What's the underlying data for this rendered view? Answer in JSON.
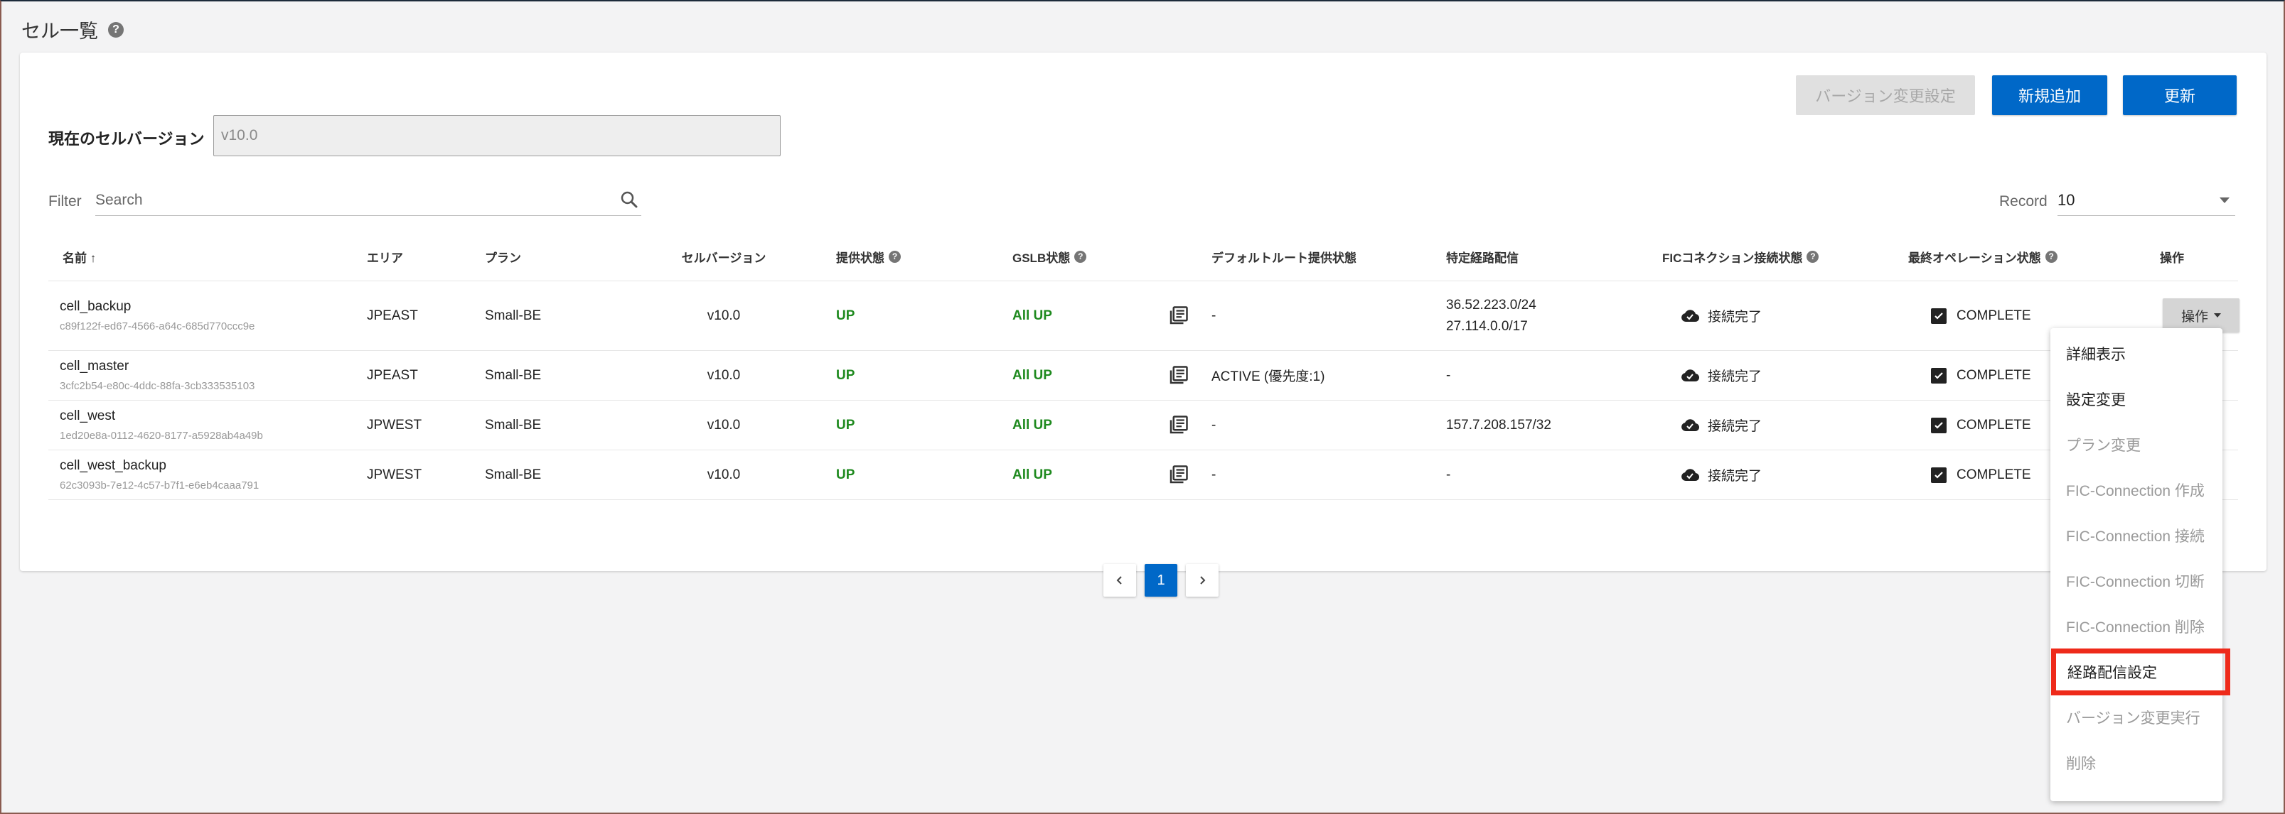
{
  "page": {
    "title": "セル一覧"
  },
  "toolbar": {
    "version_change_label": "バージョン変更設定",
    "add_label": "新規追加",
    "refresh_label": "更新"
  },
  "version": {
    "label": "現在のセルバージョン",
    "value": "v10.0"
  },
  "filter": {
    "label": "Filter",
    "placeholder": "Search"
  },
  "record": {
    "label": "Record",
    "value": "10"
  },
  "table": {
    "headers": {
      "name": "名前 ↑",
      "area": "エリア",
      "plan": "プラン",
      "cell_version": "セルバージョン",
      "service_status": "提供状態",
      "gslb_status": "GSLB状態",
      "default_route": "デフォルトルート提供状態",
      "specific_route": "特定経路配信",
      "fic_status": "FICコネクション接続状態",
      "last_op": "最終オペレーション状態",
      "action": "操作"
    },
    "rows": [
      {
        "name": "cell_backup",
        "id": "c89f122f-ed67-4566-a64c-685d770ccc9e",
        "area": "JPEAST",
        "plan": "Small-BE",
        "version": "v10.0",
        "status": "UP",
        "gslb": "All UP",
        "default_route": "-",
        "routes": [
          "36.52.223.0/24",
          "27.114.0.0/17"
        ],
        "fic": "接続完了",
        "last_op": "COMPLETE",
        "action": "操作"
      },
      {
        "name": "cell_master",
        "id": "3cfc2b54-e80c-4ddc-88fa-3cb333535103",
        "area": "JPEAST",
        "plan": "Small-BE",
        "version": "v10.0",
        "status": "UP",
        "gslb": "All UP",
        "default_route": "ACTIVE (優先度:1)",
        "routes": [
          "-"
        ],
        "fic": "接続完了",
        "last_op": "COMPLETE"
      },
      {
        "name": "cell_west",
        "id": "1ed20e8a-0112-4620-8177-a5928ab4a49b",
        "area": "JPWEST",
        "plan": "Small-BE",
        "version": "v10.0",
        "status": "UP",
        "gslb": "All UP",
        "default_route": "-",
        "routes": [
          "157.7.208.157/32"
        ],
        "fic": "接続完了",
        "last_op": "COMPLETE"
      },
      {
        "name": "cell_west_backup",
        "id": "62c3093b-7e12-4c57-b7f1-e6eb4caaa791",
        "area": "JPWEST",
        "plan": "Small-BE",
        "version": "v10.0",
        "status": "UP",
        "gslb": "All UP",
        "default_route": "-",
        "routes": [
          "-"
        ],
        "fic": "接続完了",
        "last_op": "COMPLETE"
      }
    ]
  },
  "pagination": {
    "current": "1"
  },
  "menu": {
    "items": [
      {
        "label": "詳細表示",
        "disabled": false
      },
      {
        "label": "設定変更",
        "disabled": false
      },
      {
        "label": "プラン変更",
        "disabled": true
      },
      {
        "label": "FIC-Connection 作成",
        "disabled": true
      },
      {
        "label": "FIC-Connection 接続",
        "disabled": true
      },
      {
        "label": "FIC-Connection 切断",
        "disabled": true
      },
      {
        "label": "FIC-Connection 削除",
        "disabled": true
      },
      {
        "label": "経路配信設定",
        "disabled": false,
        "highlighted": true
      },
      {
        "label": "バージョン変更実行",
        "disabled": true
      },
      {
        "label": "削除",
        "disabled": true
      }
    ]
  },
  "colors": {
    "primary": "#0068c8",
    "up_green": "#1f8a1f",
    "highlight": "#ee2a1a"
  }
}
